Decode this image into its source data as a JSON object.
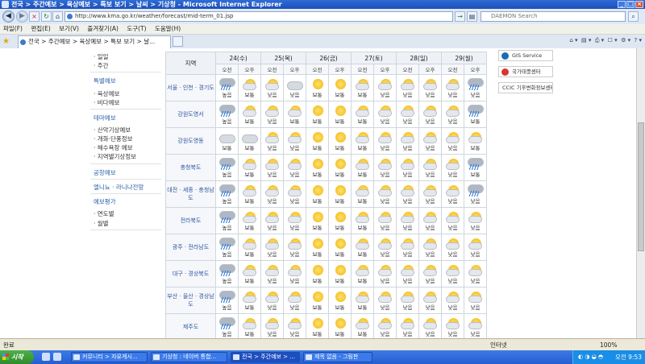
{
  "window": {
    "title": "전국 > 주간예보 > 육상예보 > 특보 보기 > 날씨 > 기상청 - Microsoft Internet Explorer"
  },
  "addressbar": {
    "url": "http://www.kma.go.kr/weather/forecast/mid-term_01.jsp",
    "search_placeholder": "DAEMON Search"
  },
  "menu": [
    "파일(F)",
    "편집(E)",
    "보기(V)",
    "즐겨찾기(A)",
    "도구(T)",
    "도움말(H)"
  ],
  "tab": {
    "title": "전국 > 주간예보 > 육상예보 > 특보 보기 > 날..."
  },
  "left_menu": {
    "group1": [
      "· 일일",
      "· 주간"
    ],
    "special_heading": "특별예보",
    "special_items": [
      "· 육상예보",
      "· 비다예보"
    ],
    "theme_heading": "테마예보",
    "theme_items": [
      "· 산악기상예보",
      "· 개화·단풍정보",
      "· 해수욕장 예보",
      "· 지역별기상정보"
    ],
    "other_headings": [
      "공항예보",
      "엘니뇨 · 라니냐전망",
      "예보평가"
    ],
    "eval_items": [
      "· 연도별",
      "· 월별"
    ]
  },
  "table": {
    "region_header": "지역",
    "days": [
      "24(수)",
      "25(목)",
      "26(금)",
      "27(토)",
      "28(일)",
      "29(월)"
    ],
    "am": "오전",
    "pm": "오후",
    "regions": [
      {
        "name": "서울 · 인천 · 경기도",
        "cells": [
          [
            "rain",
            "높음"
          ],
          [
            "sun-cloud",
            "보통"
          ],
          [
            "sun-cloud",
            "낮음"
          ],
          [
            "cloud",
            "낮음"
          ],
          [
            "sun",
            "보통"
          ],
          [
            "sun",
            "보통"
          ],
          [
            "sun-cloud",
            "보통"
          ],
          [
            "sun-cloud",
            "낮음"
          ],
          [
            "sun-cloud",
            "낮음"
          ],
          [
            "sun-cloud",
            "낮음"
          ],
          [
            "sun-cloud",
            "낮음"
          ],
          [
            "rain",
            "낮음"
          ]
        ]
      },
      {
        "name": "강원도영서",
        "cells": [
          [
            "rain",
            "높음"
          ],
          [
            "sun-cloud",
            "보통"
          ],
          [
            "sun-cloud",
            "낮음"
          ],
          [
            "sun-cloud",
            "보통"
          ],
          [
            "sun",
            "보통"
          ],
          [
            "sun",
            "보통"
          ],
          [
            "sun-cloud",
            "보통"
          ],
          [
            "sun-cloud",
            "낮음"
          ],
          [
            "sun-cloud",
            "낮음"
          ],
          [
            "sun-cloud",
            "낮음"
          ],
          [
            "sun-cloud",
            "낮음"
          ],
          [
            "rain",
            "보통"
          ]
        ]
      },
      {
        "name": "강원도영동",
        "cells": [
          [
            "cloud",
            "보통"
          ],
          [
            "cloud",
            "보통"
          ],
          [
            "sun-cloud",
            "낮음"
          ],
          [
            "sun-cloud",
            "낮음"
          ],
          [
            "sun",
            "보통"
          ],
          [
            "sun",
            "보통"
          ],
          [
            "sun-cloud",
            "보통"
          ],
          [
            "sun-cloud",
            "낮음"
          ],
          [
            "sun-cloud",
            "낮음"
          ],
          [
            "sun-cloud",
            "낮음"
          ],
          [
            "sun-cloud",
            "낮음"
          ],
          [
            "sun-cloud",
            "보통"
          ]
        ]
      },
      {
        "name": "충청북도",
        "cells": [
          [
            "rain",
            "높음"
          ],
          [
            "sun-cloud",
            "보통"
          ],
          [
            "sun-cloud",
            "낮음"
          ],
          [
            "sun-cloud",
            "낮음"
          ],
          [
            "sun",
            "보통"
          ],
          [
            "sun",
            "보통"
          ],
          [
            "sun-cloud",
            "보통"
          ],
          [
            "sun-cloud",
            "낮음"
          ],
          [
            "sun-cloud",
            "낮음"
          ],
          [
            "sun-cloud",
            "낮음"
          ],
          [
            "sun-cloud",
            "낮음"
          ],
          [
            "rain",
            "보통"
          ]
        ]
      },
      {
        "name": "대전 · 세종 · 충청남도",
        "cells": [
          [
            "rain",
            "높음"
          ],
          [
            "sun-cloud",
            "보통"
          ],
          [
            "sun-cloud",
            "낮음"
          ],
          [
            "sun-cloud",
            "낮음"
          ],
          [
            "sun",
            "보통"
          ],
          [
            "sun",
            "보통"
          ],
          [
            "sun-cloud",
            "보통"
          ],
          [
            "sun-cloud",
            "낮음"
          ],
          [
            "sun-cloud",
            "낮음"
          ],
          [
            "sun-cloud",
            "낮음"
          ],
          [
            "sun-cloud",
            "낮음"
          ],
          [
            "rain",
            "낮음"
          ]
        ]
      },
      {
        "name": "전라북도",
        "cells": [
          [
            "rain",
            "높음"
          ],
          [
            "sun-cloud",
            "보통"
          ],
          [
            "sun-cloud",
            "낮음"
          ],
          [
            "sun-cloud",
            "낮음"
          ],
          [
            "sun",
            "보통"
          ],
          [
            "sun",
            "보통"
          ],
          [
            "sun-cloud",
            "보통"
          ],
          [
            "sun-cloud",
            "낮음"
          ],
          [
            "sun-cloud",
            "낮음"
          ],
          [
            "sun-cloud",
            "낮음"
          ],
          [
            "sun-cloud",
            "낮음"
          ],
          [
            "sun-cloud",
            "낮음"
          ]
        ]
      },
      {
        "name": "광주 · 전라남도",
        "cells": [
          [
            "rain",
            "높음"
          ],
          [
            "sun-cloud",
            "보통"
          ],
          [
            "sun-cloud",
            "낮음"
          ],
          [
            "sun-cloud",
            "낮음"
          ],
          [
            "sun",
            "보통"
          ],
          [
            "sun",
            "보통"
          ],
          [
            "sun-cloud",
            "보통"
          ],
          [
            "sun-cloud",
            "낮음"
          ],
          [
            "sun-cloud",
            "낮음"
          ],
          [
            "sun-cloud",
            "낮음"
          ],
          [
            "sun-cloud",
            "낮음"
          ],
          [
            "sun-cloud",
            "낮음"
          ]
        ]
      },
      {
        "name": "대구 · 경상북도",
        "cells": [
          [
            "rain",
            "높음"
          ],
          [
            "sun-cloud",
            "보통"
          ],
          [
            "sun-cloud",
            "낮음"
          ],
          [
            "sun-cloud",
            "낮음"
          ],
          [
            "sun",
            "보통"
          ],
          [
            "sun",
            "보통"
          ],
          [
            "sun-cloud",
            "보통"
          ],
          [
            "sun-cloud",
            "낮음"
          ],
          [
            "sun-cloud",
            "낮음"
          ],
          [
            "sun-cloud",
            "낮음"
          ],
          [
            "sun-cloud",
            "낮음"
          ],
          [
            "sun-cloud",
            "낮음"
          ]
        ]
      },
      {
        "name": "부산 · 울산 · 경상남도",
        "cells": [
          [
            "rain",
            "높음"
          ],
          [
            "sun-cloud",
            "보통"
          ],
          [
            "sun-cloud",
            "낮음"
          ],
          [
            "sun-cloud",
            "낮음"
          ],
          [
            "sun",
            "보통"
          ],
          [
            "sun",
            "보통"
          ],
          [
            "sun-cloud",
            "보통"
          ],
          [
            "sun-cloud",
            "낮음"
          ],
          [
            "sun-cloud",
            "낮음"
          ],
          [
            "sun-cloud",
            "낮음"
          ],
          [
            "sun-cloud",
            "낮음"
          ],
          [
            "sun-cloud",
            "낮음"
          ]
        ]
      },
      {
        "name": "제주도",
        "cells": [
          [
            "rain",
            "높음"
          ],
          [
            "sun-cloud",
            "보통"
          ],
          [
            "sun-cloud",
            "낮음"
          ],
          [
            "sun-cloud",
            "낮음"
          ],
          [
            "sun",
            "보통"
          ],
          [
            "sun",
            "보통"
          ],
          [
            "sun-cloud",
            "보통"
          ],
          [
            "sun-cloud",
            "낮음"
          ],
          [
            "sun-cloud",
            "낮음"
          ],
          [
            "sun-cloud",
            "낮음"
          ],
          [
            "sun-cloud",
            "낮음"
          ],
          [
            "sun-cloud",
            "낮음"
          ]
        ]
      }
    ]
  },
  "side_logos": [
    "GIS Service",
    "국가태풍센터",
    "CCIC 기후변화정보센터"
  ],
  "status": {
    "left": "완료",
    "zone": "인터넷",
    "zoom": "100%"
  },
  "taskbar": {
    "start": "시작",
    "tasks": [
      "커뮤니티 > 자유게시...",
      "기상청 : 네이버 통합...",
      "전국 > 주간예보 > ...",
      "제목 없음 - 그림판"
    ],
    "clock": "오전 9:53"
  },
  "colors": {
    "title_bar": "#1d4fb8",
    "link_blue": "#2c5fa8",
    "rain": "#2a78d8",
    "sun": "#f2b312"
  }
}
